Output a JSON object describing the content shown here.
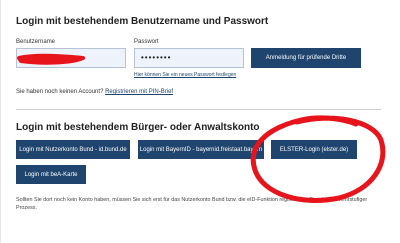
{
  "login_section": {
    "title": "Login mit bestehendem Benutzername und Passwort",
    "username_label": "Benutzername",
    "username_value": "",
    "password_label": "Passwort",
    "password_value": "••••••••",
    "forgot_password_link": "Hier können Sie ein neues Passwort festlegen",
    "third_party_button": "Anmeldung für prüfende Dritte",
    "no_account_text": "Sie haben noch keinen Account?",
    "register_link": "Registrieren mit PIN-Brief"
  },
  "account_section": {
    "title": "Login mit bestehendem Bürger- oder Anwaltskonto",
    "buttons": [
      "Login mit Nutzerkonto Bund - id.bund.de",
      "Login mit BayernID - bayernid.freistaat.bayern",
      "ELSTER-Login (elster.de)",
      "Login mit beA-Karte"
    ],
    "note": "Sollten Sie dort noch kein Konto haben, müssen Sie sich erst für das Nutzerkonto Bund bzw. die eID-Funktion registrieren. Dies ist ein mehrstufiger Prozess."
  },
  "colors": {
    "button_bg": "#1f456e",
    "annotation_red": "#e8141c"
  }
}
